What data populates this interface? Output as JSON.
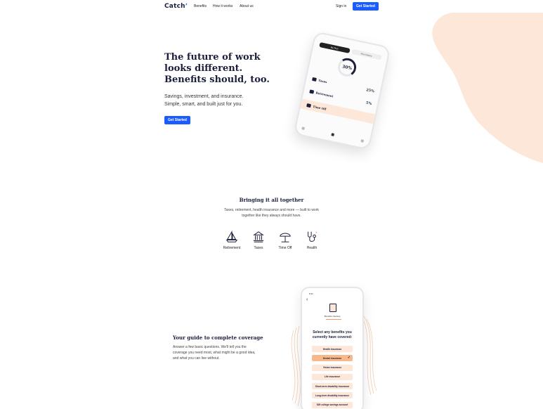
{
  "nav": {
    "logo": "Catch",
    "links": [
      "Benefits",
      "How it works",
      "About us"
    ],
    "signin": "Sign in",
    "cta": "Get Started"
  },
  "hero": {
    "title_lines": [
      "The future of work",
      "looks different.",
      "Benefits should, too."
    ],
    "subtitle_lines": [
      "Savings, investment, and insurance.",
      "Simple, smart, and built just for you."
    ],
    "cta": "Get Started"
  },
  "phone1": {
    "tabs": [
      "My Plan",
      "Plan History"
    ],
    "ring_value": "30%",
    "rows": [
      {
        "label": "Taxes",
        "pct": "25%"
      },
      {
        "label": "Retirement",
        "pct": "5%"
      },
      {
        "label": "Time Off",
        "pct": ""
      }
    ]
  },
  "together": {
    "title": "Bringing it all together",
    "subtitle": "Taxes, retirement, health insurance and more — built to work together like they always should have.",
    "features": [
      {
        "label": "Retirement",
        "icon": "sailboat-icon"
      },
      {
        "label": "Taxes",
        "icon": "building-icon"
      },
      {
        "label": "Time Off",
        "icon": "umbrella-icon"
      },
      {
        "label": "Health",
        "icon": "stethoscope-icon"
      }
    ]
  },
  "coverage": {
    "title": "Your guide to complete coverage",
    "subtitle": "Answer a few basic questions. We'll tell you the coverage you need most, what might be a good idea, and what you can live without."
  },
  "phone2": {
    "time": "9:41",
    "header_label": "Benefits checkup",
    "question": "Select any benefits you currently have covered:",
    "options": [
      {
        "label": "Health insurance",
        "selected": false
      },
      {
        "label": "Dental insurance",
        "selected": true
      },
      {
        "label": "Vision insurance",
        "selected": false
      },
      {
        "label": "Life insurance",
        "selected": false
      },
      {
        "label": "Short-term disability insurance",
        "selected": false
      },
      {
        "label": "Long-term disability insurance",
        "selected": false
      },
      {
        "label": "529 college savings account",
        "selected": false
      }
    ]
  },
  "colors": {
    "accent": "#1a5cff",
    "navy": "#1b1f3b",
    "peach": "#fde7d8",
    "peach_selected": "#f7b98b"
  }
}
